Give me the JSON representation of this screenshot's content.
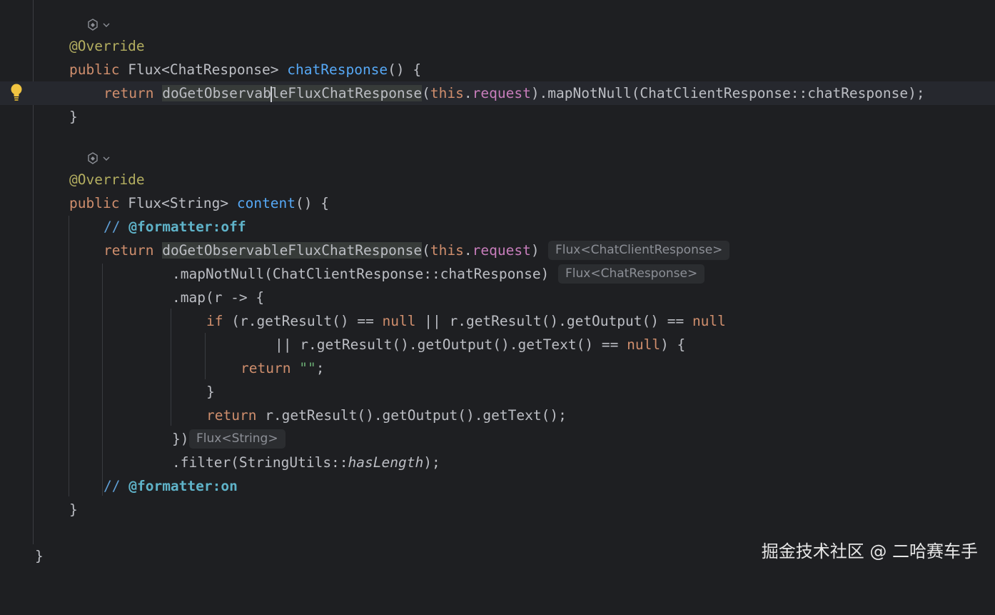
{
  "editor": {
    "lines": {
      "override_1": "@Override",
      "sig_1": {
        "public": "public",
        "type": "Flux<ChatResponse>",
        "name": "chatResponse",
        "tail": "() {"
      },
      "ret_1": {
        "kw": "return",
        "method_a": "doGetObservab",
        "method_b": "leFluxChatResponse",
        "open": "(",
        "this_kw": "this",
        "dot": ".",
        "field": "request",
        "rest": ").mapNotNull(ChatClientResponse::chatResponse);"
      },
      "close_1": "}",
      "override_2": "@Override",
      "sig_2": {
        "public": "public",
        "type": "Flux<String>",
        "name": "content",
        "tail": "() {"
      },
      "cmt_off": {
        "slashes": "// ",
        "tag": "@formatter:off"
      },
      "ret_2": {
        "kw": "return",
        "method": "doGetObservableFluxChatResponse",
        "open": "(",
        "this_kw": "this",
        "dot": ".",
        "field": "request",
        "close": ")"
      },
      "map_not_null": ".mapNotNull(ChatClientResponse::chatResponse)",
      "map_open": ".map(r -> {",
      "if_line": {
        "if_kw": "if",
        "a": " (r.getResult() == ",
        "null1": "null",
        "b": " || r.getResult().getOutput() == ",
        "null2": "null"
      },
      "or_line": {
        "a": "|| r.getResult().getOutput().getText() == ",
        "null3": "null",
        "b": ") {"
      },
      "ret_empty": {
        "kw": "return",
        "str": "\"\"",
        "semi": ";"
      },
      "close_if": "}",
      "ret_text": {
        "kw": "return",
        "rest": " r.getResult().getOutput().getText();"
      },
      "map_close": "})",
      "filter": {
        "a": ".filter(StringUtils::",
        "method": "hasLength",
        "b": ");"
      },
      "cmt_on": {
        "slashes": "// ",
        "tag": "@formatter:on"
      },
      "close_2": "}",
      "close_class": "}"
    },
    "inlay_hints": {
      "ret_2": "Flux<ChatClientResponse>",
      "map_not_null": "Flux<ChatResponse>",
      "map_close": "Flux<String>"
    },
    "icons": {
      "bulb": "lightbulb-icon",
      "fold": "implements-method-gutter-icon"
    }
  },
  "watermark": "掘金技术社区 @ 二哈赛车手",
  "colors": {
    "background": "#1e1f22",
    "keyword": "#cf8e6d",
    "annotation": "#b3ae60",
    "method_decl": "#56a8f5",
    "field": "#c77dbb",
    "string": "#6aab73",
    "comment": "#5f9fd6",
    "text": "#bcbec4",
    "bulb": "#f0c441"
  }
}
